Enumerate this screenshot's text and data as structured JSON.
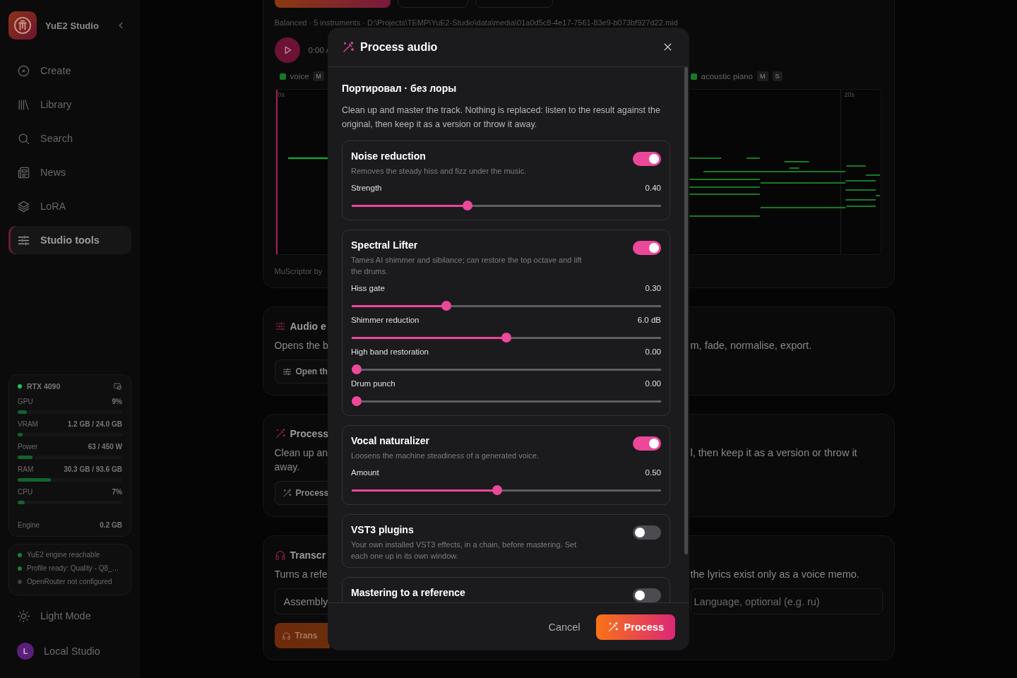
{
  "sidebar": {
    "brand": "YuE2 Studio",
    "nav": [
      {
        "label": "Create",
        "selected": false
      },
      {
        "label": "Library",
        "selected": false
      },
      {
        "label": "Search",
        "selected": false
      },
      {
        "label": "News",
        "selected": false
      },
      {
        "label": "LoRA",
        "selected": false
      },
      {
        "label": "Studio tools",
        "selected": true
      }
    ],
    "gpu_card": {
      "name": "RTX 4090",
      "metrics": [
        {
          "label": "GPU",
          "value": "9%",
          "level": 0.09
        },
        {
          "label": "VRAM",
          "value": "1.2 GB / 24.0 GB",
          "level": 0.05
        },
        {
          "label": "Power",
          "value": "63 / 450 W",
          "level": 0.14
        },
        {
          "label": "RAM",
          "value": "30.3 GB / 93.6 GB",
          "level": 0.32
        },
        {
          "label": "CPU",
          "value": "7%",
          "level": 0.07
        }
      ],
      "engine": {
        "label": "Engine",
        "value": "0.2 GB"
      }
    },
    "status": [
      {
        "text": "YuE2 engine reachable",
        "color": "#15803d"
      },
      {
        "text": "Profile ready: Quality - Q8_…",
        "color": "#15803d"
      },
      {
        "text": "OpenRouter not configured",
        "color": "#3f3f46"
      }
    ],
    "theme_toggle": "Light Mode",
    "user": {
      "initial": "L",
      "name": "Local Studio"
    }
  },
  "track_card": {
    "meta": "Balanced · 5 instruments · D:\\Projects\\TEMP\\YuE2-Studio\\data\\media\\01a0d5c8-4e17-7561-83e9-b073bf927d22.mid",
    "time": "0:00 /",
    "tracks": [
      {
        "name": "voice",
        "badges": [
          "M"
        ]
      },
      {
        "name": "acoustic piano",
        "badges": [
          "M",
          "S"
        ]
      }
    ],
    "roll_labels": [
      "0s",
      "20s"
    ],
    "credit": "MuScriptor by"
  },
  "tool_cards": [
    {
      "title": "Audio e",
      "lines": [
        "Opens the b"
      ],
      "right_text": "m, fade, normalise, export.",
      "button": {
        "label": "Open th",
        "kind": "outline"
      }
    },
    {
      "title": "Process",
      "lines": [
        "Clean up an",
        "away."
      ],
      "right_text": "l, then keep it as a version or throw it",
      "button": {
        "label": "Process",
        "kind": "outline"
      }
    },
    {
      "title": "Transcr",
      "lines": [
        "Turns a refe"
      ],
      "right_text": "the lyrics exist only as a voice memo.",
      "fields": {
        "select_value": "Assembly",
        "placeholder": "Language, optional (e.g. ru)"
      },
      "button": {
        "label": "Trans",
        "kind": "primary"
      }
    }
  ],
  "dialog": {
    "title": "Process audio",
    "subtitle": "Портировал · без лоры",
    "description": "Clean up and master the track. Nothing is replaced: listen to the result against the original, then keep it as a version or throw it away.",
    "sections": [
      {
        "title": "Noise reduction",
        "description": "Removes the steady hiss and fizz under the music.",
        "on": true,
        "sliders": [
          {
            "label": "Strength",
            "reading": "0.40",
            "level": 0.37
          }
        ]
      },
      {
        "title": "Spectral Lifter",
        "description": "Tames AI shimmer and sibilance; can restore the top octave and lift the drums.",
        "on": true,
        "sliders": [
          {
            "label": "Hiss gate",
            "reading": "0.30",
            "level": 0.3
          },
          {
            "label": "Shimmer reduction",
            "reading": "6.0 dB",
            "level": 0.5
          },
          {
            "label": "High band restoration",
            "reading": "0.00",
            "level": 0
          },
          {
            "label": "Drum punch",
            "reading": "0.00",
            "level": 0
          }
        ]
      },
      {
        "title": "Vocal naturalizer",
        "description": "Loosens the machine steadiness of a generated voice.",
        "on": true,
        "sliders": [
          {
            "label": "Amount",
            "reading": "0.50",
            "level": 0.47
          }
        ]
      },
      {
        "title": "VST3 plugins",
        "description": "Your own installed VST3 effects, in a chain, before mastering. Set each one up in its own window.",
        "on": false
      },
      {
        "title": "Mastering to a reference",
        "on": false
      }
    ],
    "cancel": "Cancel",
    "confirm": "Process"
  }
}
